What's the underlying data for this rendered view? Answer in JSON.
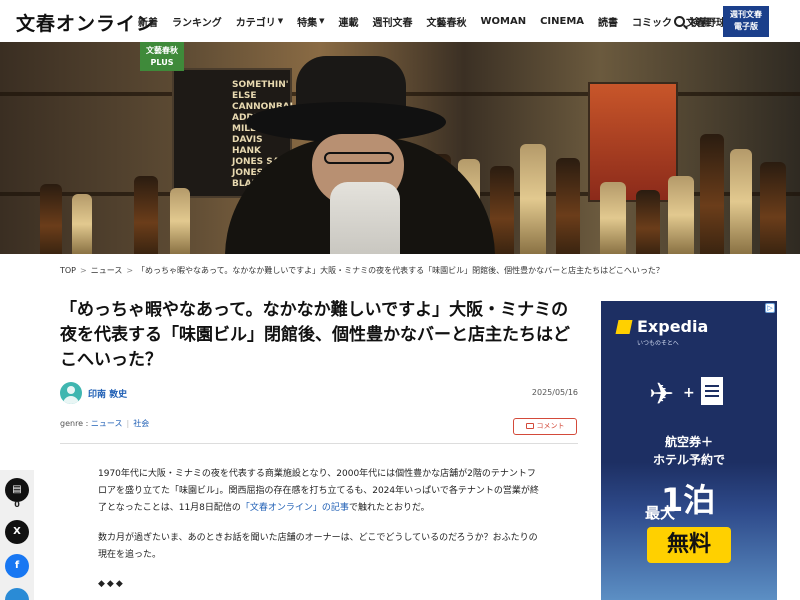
{
  "header": {
    "logo": "文春オンライン",
    "nav": [
      {
        "label": "新着",
        "dropdown": false
      },
      {
        "label": "ランキング",
        "dropdown": false
      },
      {
        "label": "カテゴリ",
        "dropdown": true
      },
      {
        "label": "特集",
        "dropdown": true
      },
      {
        "label": "連載",
        "dropdown": false
      },
      {
        "label": "週刊文春",
        "dropdown": false
      },
      {
        "label": "文藝春秋",
        "dropdown": false
      },
      {
        "label": "WOMAN",
        "dropdown": false
      },
      {
        "label": "CINEMA",
        "dropdown": false
      },
      {
        "label": "読書",
        "dropdown": false
      },
      {
        "label": "コミック",
        "dropdown": false
      },
      {
        "label": "文春野球",
        "dropdown": false
      }
    ],
    "search_label": "検索",
    "weekly_btn_line1": "週刊文春",
    "weekly_btn_line2": "電子版"
  },
  "hero": {
    "badge_line1": "文藝春秋",
    "badge_line2": "PLUS",
    "poster_text": "SOMETHIN' ELSE CANNONBALL ADDERLEY MILES DAVIS HANK JONES SAM JONES ART BLAKEY"
  },
  "breadcrumb": {
    "items": [
      "TOP",
      "ニュース",
      "「めっちゃ暇やなあって。なかなか難しいですよ」大阪・ミナミの夜を代表する「味園ビル」閉館後、個性豊かなバーと店主たちはどこへいった？"
    ]
  },
  "article": {
    "title": "「めっちゃ暇やなあって。なかなか難しいですよ」大阪・ミナミの夜を代表する「味園ビル」閉館後、個性豊かなバーと店主たちはどこへいった？",
    "author": "印南 敦史",
    "date": "2025/05/16",
    "genre_label": "genre :",
    "genres": [
      "ニュース",
      "社会"
    ],
    "comment_label": "コメント",
    "p1_before": "1970年代に大阪・ミナミの夜を代表する商業施設となり、2000年代には個性豊かな店舗が2階のテナントフロアを盛り立てた「味園ビル」。関西屈指の存在感を打ち立てるも、2024年いっぱいで各テナントの営業が終了となったことは、11月8日配信の",
    "p1_link": "「文春オンライン」の記事",
    "p1_after": "で触れたとおりだ。",
    "p2": "数カ月が過ぎたいま、あのときお話を聞いた店舗のオーナーは、どこでどうしているのだろうか？おふたりの現在を追った。",
    "p3": "◆◆◆"
  },
  "share": {
    "comment_count": "0",
    "x_label": "X",
    "facebook_label": "f"
  },
  "ad": {
    "brand": "Expedia",
    "tagline": "いつものそとへ",
    "line1": "航空券＋",
    "line2": "ホテル予約で",
    "big_prefix": "最大",
    "big_value": "1泊",
    "free": "無料",
    "plus": "+"
  },
  "colors": {
    "accent_blue": "#1f5fb5",
    "weekly_blue": "#1b3f8b",
    "comment_red": "#d34a3a",
    "plus_green": "#3f8a3a",
    "ad_navy": "#1d2f63",
    "ad_yellow": "#ffd000"
  }
}
